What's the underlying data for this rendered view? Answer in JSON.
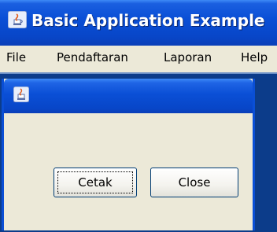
{
  "window": {
    "title": "Basic Application Example",
    "icon": "java-cup-icon"
  },
  "menu": {
    "items": [
      "File",
      "Pendaftaran",
      "Laporan",
      "Help"
    ]
  },
  "internal_frame": {
    "icon": "java-cup-icon",
    "buttons": {
      "cetak_label": "Cetak",
      "close_label": "Close"
    }
  },
  "colors": {
    "titlebar": "#0a4fd6",
    "desktop": "#0c3c8a",
    "window_bg": "#ece9d8"
  }
}
